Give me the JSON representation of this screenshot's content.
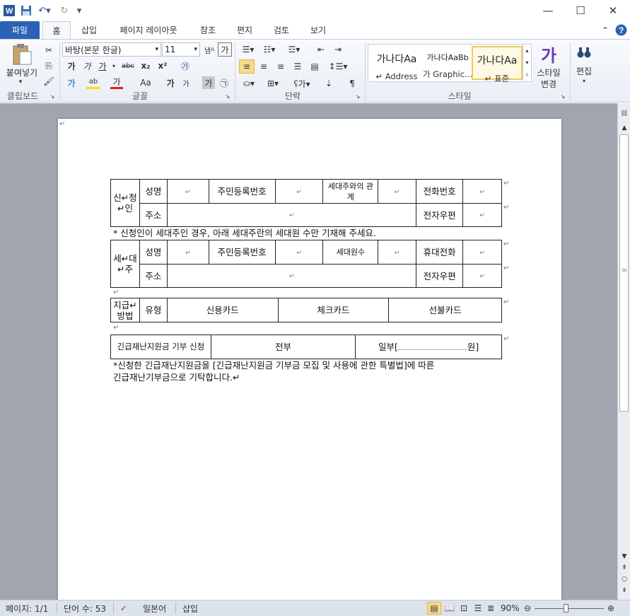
{
  "quick_access": {
    "word_icon": "word-logo-icon",
    "save_icon": "save-icon",
    "undo_icon": "undo-icon",
    "redo_icon": "redo-icon",
    "customize_icon": "customize-quick-access-icon"
  },
  "window": {
    "minimize": "—",
    "maximize": "☐",
    "close": "✕"
  },
  "tabs": [
    {
      "label": "파일"
    },
    {
      "label": "홈"
    },
    {
      "label": "삽입"
    },
    {
      "label": "페이지 레이아웃"
    },
    {
      "label": "참조"
    },
    {
      "label": "편지"
    },
    {
      "label": "검토"
    },
    {
      "label": "보기"
    }
  ],
  "ribbon": {
    "clipboard": {
      "paste_label": "붙여넣기",
      "group_label": "클립보드"
    },
    "font": {
      "font_name": "바탕(본문 한글)",
      "font_size": "11",
      "group_label": "글꼴",
      "bold": "가",
      "italic": "가",
      "underline": "가",
      "strike": "ㅋ",
      "subscript": "x₂",
      "superscript": "x²",
      "grow": "가",
      "shrink": "가",
      "case": "Aa",
      "font_color": "가",
      "char_shading": "가",
      "char_border": "가",
      "phonetic": "㉮",
      "effects": "가"
    },
    "paragraph": {
      "group_label": "단락"
    },
    "styles": {
      "group_label": "스타일",
      "items": [
        {
          "sample": "가나다Aa",
          "name": "↵ Address"
        },
        {
          "sample": "가나다AaBb",
          "name": "가 Graphic..."
        },
        {
          "sample": "가나다Aa",
          "name": "↵ 표준"
        }
      ],
      "change_style_label1": "스타일",
      "change_style_label2": "변경",
      "change_style_icon": "가"
    },
    "editing": {
      "label": "편집"
    }
  },
  "document": {
    "table1": {
      "header": "신↵청↵인",
      "name_label": "성명",
      "rrn_label": "주민등록번호",
      "relation_label": "세대주와의 관계",
      "phone_label": "전화번호",
      "address_label": "주소",
      "email_label": "전자우편"
    },
    "note1": "* 신청인이 세대주인 경우, 아래 세대주란의 세대원 수만 기재해 주세요.",
    "table2": {
      "header": "세↵대↵주",
      "name_label": "성명",
      "rrn_label": "주민등록번호",
      "members_label": "세대원수",
      "mobile_label": "휴대전화",
      "address_label": "주소",
      "email_label": "전자우편"
    },
    "table3": {
      "method_label": "지급↵방법",
      "type_label": "유형",
      "credit": "신용카드",
      "check": "체크카드",
      "prepaid": "선불카드"
    },
    "table4": {
      "donation_label": "긴급재난지원금 기부 신청",
      "all": "전부",
      "partial": "일부[",
      "partial_end": "원]"
    },
    "note2_line1": "*신청한 긴급재난지원금을 [긴급재난지원금 기부금 모집 및 사용에 관한 특별법]에 따른",
    "note2_line2": "긴급재난기부금으로 기탁합니다.↵"
  },
  "status": {
    "page": "페이지: 1/1",
    "words": "단어 수: 53",
    "language": "일본어",
    "mode": "삽입",
    "zoom": "90%",
    "zoom_value": 90
  },
  "colors": {
    "file_tab": "#2b62b5",
    "ribbon_bg": "#e9eef5",
    "workspace_bg": "#a0a5ae",
    "status_bg": "#dde3ea"
  }
}
